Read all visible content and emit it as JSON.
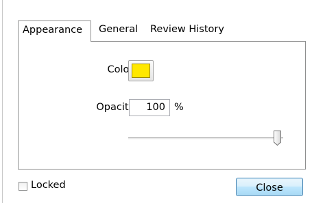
{
  "tabs": [
    {
      "label": "Appearance",
      "active": true
    },
    {
      "label": "General",
      "active": false
    },
    {
      "label": "Review History",
      "active": false
    }
  ],
  "appearance": {
    "color_label": "Color:",
    "color_value": "#ffe800",
    "opacity_label": "Opacity:",
    "opacity_value": "100",
    "opacity_unit": "%",
    "opacity_slider_fraction": 1.0
  },
  "footer": {
    "locked_label": "Locked",
    "locked_checked": false,
    "close_label": "Close"
  }
}
